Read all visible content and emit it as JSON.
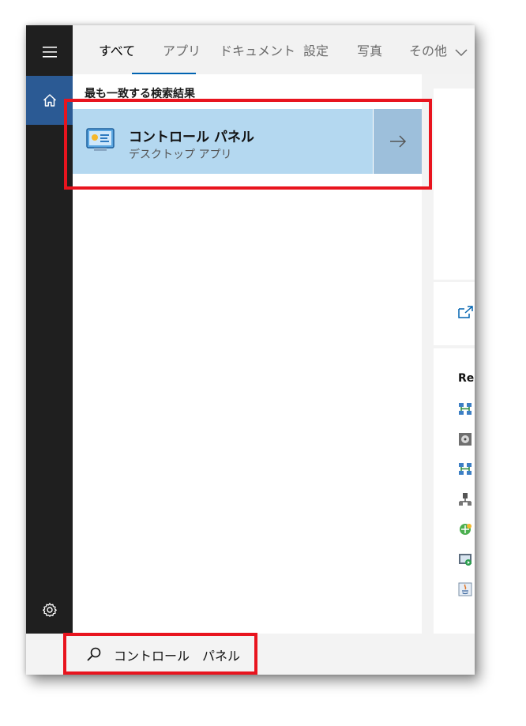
{
  "tabs": [
    {
      "label": "すべて",
      "active": true
    },
    {
      "label": "アプリ",
      "active": false
    },
    {
      "label": "ドキュメント",
      "active": false
    },
    {
      "label": "設定",
      "active": false
    },
    {
      "label": "写真",
      "active": false
    },
    {
      "label": "その他",
      "active": false
    }
  ],
  "best_match": {
    "header": "最も一致する検索結果",
    "title": "コントロール パネル",
    "subtitle": "デスクトップ アプリ"
  },
  "preview": {
    "recent_label": "Re"
  },
  "search": {
    "query": "コントロール　パネル"
  },
  "colors": {
    "accent": "#0063b1",
    "home_highlight": "#2b5a94",
    "selected_bg": "#b4d8f0",
    "highlight_box": "#e8141e"
  }
}
